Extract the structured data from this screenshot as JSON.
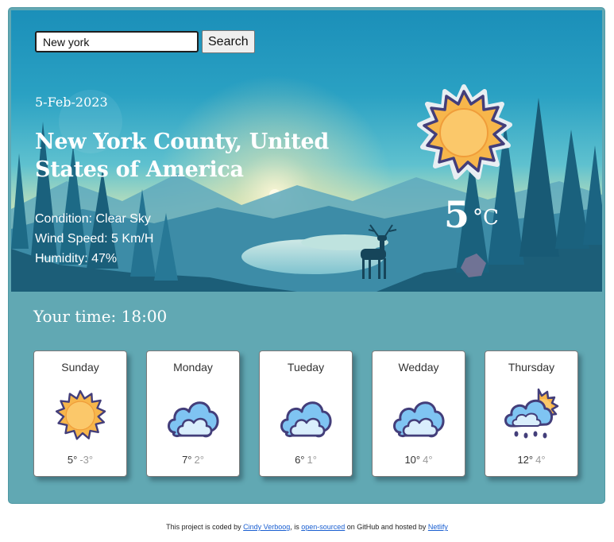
{
  "search": {
    "value": "New york",
    "button_label": "Search"
  },
  "current": {
    "date": "5-Feb-2023",
    "city": "New York County, United States of America",
    "condition": "Condition: Clear Sky",
    "wind": "Wind Speed: 5 Km/H",
    "humidity": "Humidity: 47%",
    "temperature": "5",
    "unit": "°C",
    "icon": "sun-icon"
  },
  "your_time": "Your time: 18:00",
  "forecast": [
    {
      "day": "Sunday",
      "max": "5°",
      "min": "-3°",
      "icon": "sun-icon"
    },
    {
      "day": "Monday",
      "max": "7°",
      "min": "2°",
      "icon": "cloud-icon"
    },
    {
      "day": "Tueday",
      "max": "6°",
      "min": "1°",
      "icon": "cloud-icon"
    },
    {
      "day": "Wedday",
      "max": "10°",
      "min": "4°",
      "icon": "cloud-icon"
    },
    {
      "day": "Thursday",
      "max": "12°",
      "min": "4°",
      "icon": "sun-cloud-rain-icon"
    }
  ],
  "footer": {
    "text_1": "This project is coded by ",
    "author": "Cindy Verboog",
    "text_2": ", is ",
    "open_source": "open-sourced",
    "text_3": " on GitHub and hosted by ",
    "host": "Netlify"
  },
  "colors": {
    "panel": "#61a8b3",
    "sun_fill": "#f7b64b",
    "sun_outline": "#433e7a",
    "cloud_fill": "#7fc4f2"
  }
}
